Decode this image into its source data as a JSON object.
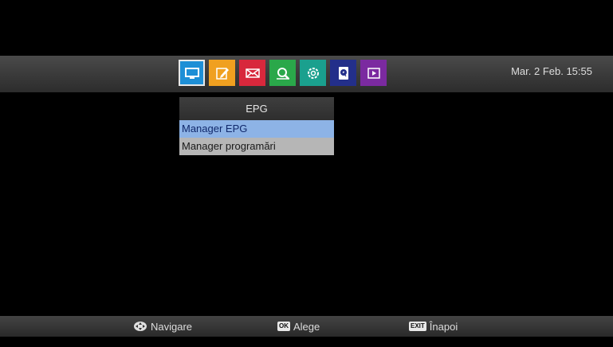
{
  "header": {
    "datetime": "Mar. 2 Feb. 15:55",
    "menu_icons": [
      {
        "name": "tv-icon",
        "color": "#1e8fd6",
        "selected": true
      },
      {
        "name": "edit-icon",
        "color": "#f0a020"
      },
      {
        "name": "mail-icon",
        "color": "#d8283c"
      },
      {
        "name": "search-icon",
        "color": "#2aa84a"
      },
      {
        "name": "settings-icon",
        "color": "#1aa08e"
      },
      {
        "name": "storage-icon",
        "color": "#232f8a"
      },
      {
        "name": "media-play-icon",
        "color": "#7b2aa0"
      }
    ]
  },
  "submenu": {
    "title": "EPG",
    "items": [
      {
        "label": "Manager EPG",
        "active": true
      },
      {
        "label": "Manager programări",
        "active": false
      }
    ]
  },
  "footer": {
    "navigate_label": "Navigare",
    "ok_key": "OK",
    "ok_label": "Alege",
    "exit_key": "EXIT",
    "exit_label": "Înapoi"
  }
}
